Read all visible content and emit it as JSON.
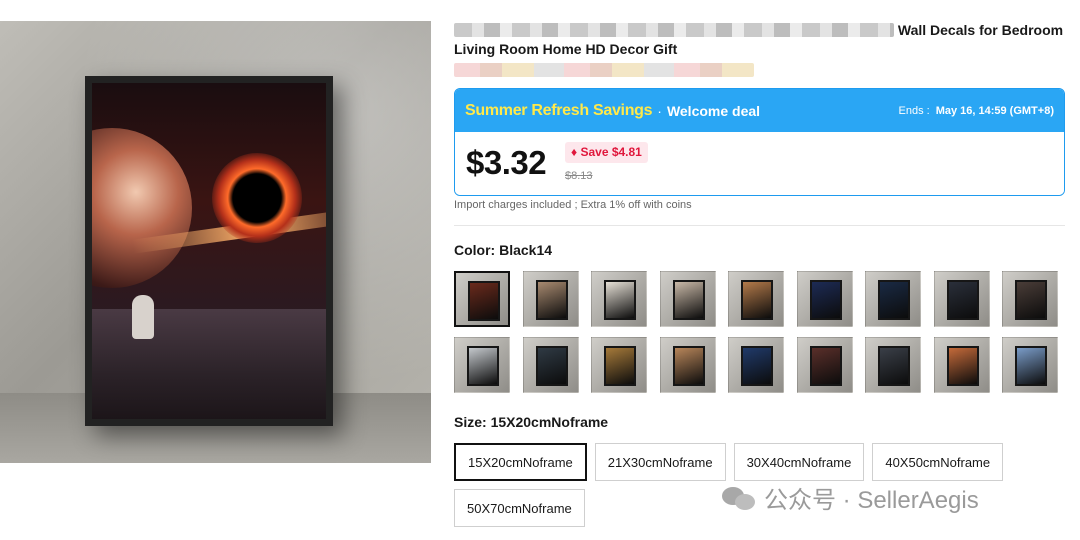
{
  "product": {
    "title_visible": "Wall Decals for Bedroom",
    "title_line2": "Living Room Home HD Decor Gift"
  },
  "deal": {
    "brand": "Summer Refresh Savings",
    "separator": "·",
    "type": "Welcome deal",
    "ends_label": "Ends :",
    "ends_date": "May 16, 14:59 (GMT+8)",
    "price": "$3.32",
    "save": "Save $4.81",
    "old_price": "$8.13",
    "import_note": "Import charges included ; Extra 1% off with coins",
    "colors": {
      "header": "#2aa6f4",
      "brand_text": "#ffe94a",
      "save_text": "#e0173c"
    }
  },
  "color_selector": {
    "label": "Color:",
    "selected": "Black14",
    "swatches": [
      {
        "id": 1,
        "tint": "#6a2a1c",
        "selected": true
      },
      {
        "id": 2,
        "tint": "#a88a70"
      },
      {
        "id": 3,
        "tint": "#e6e0d6"
      },
      {
        "id": 4,
        "tint": "#c9b9a8"
      },
      {
        "id": 5,
        "tint": "#b37a4a"
      },
      {
        "id": 6,
        "tint": "#1d2b55"
      },
      {
        "id": 7,
        "tint": "#1a2a44"
      },
      {
        "id": 8,
        "tint": "#2a2f3a"
      },
      {
        "id": 9,
        "tint": "#4a3d38"
      },
      {
        "id": 10,
        "tint": "#c4c8cc"
      },
      {
        "id": 11,
        "tint": "#2f3a44"
      },
      {
        "id": 12,
        "tint": "#a67a3a"
      },
      {
        "id": 13,
        "tint": "#b8865a"
      },
      {
        "id": 14,
        "tint": "#203a6a"
      },
      {
        "id": 15,
        "tint": "#5a2f2a"
      },
      {
        "id": 16,
        "tint": "#3a3f48"
      },
      {
        "id": 17,
        "tint": "#c46a3a"
      },
      {
        "id": 18,
        "tint": "#7a9cc8"
      }
    ]
  },
  "size_selector": {
    "label": "Size:",
    "selected": "15X20cmNoframe",
    "options": [
      "15X20cmNoframe",
      "21X30cmNoframe",
      "30X40cmNoframe",
      "40X50cmNoframe",
      "50X70cmNoframe"
    ]
  },
  "watermark": {
    "text": "公众号 · SellerAegis",
    "icon": "wechat-icon"
  }
}
